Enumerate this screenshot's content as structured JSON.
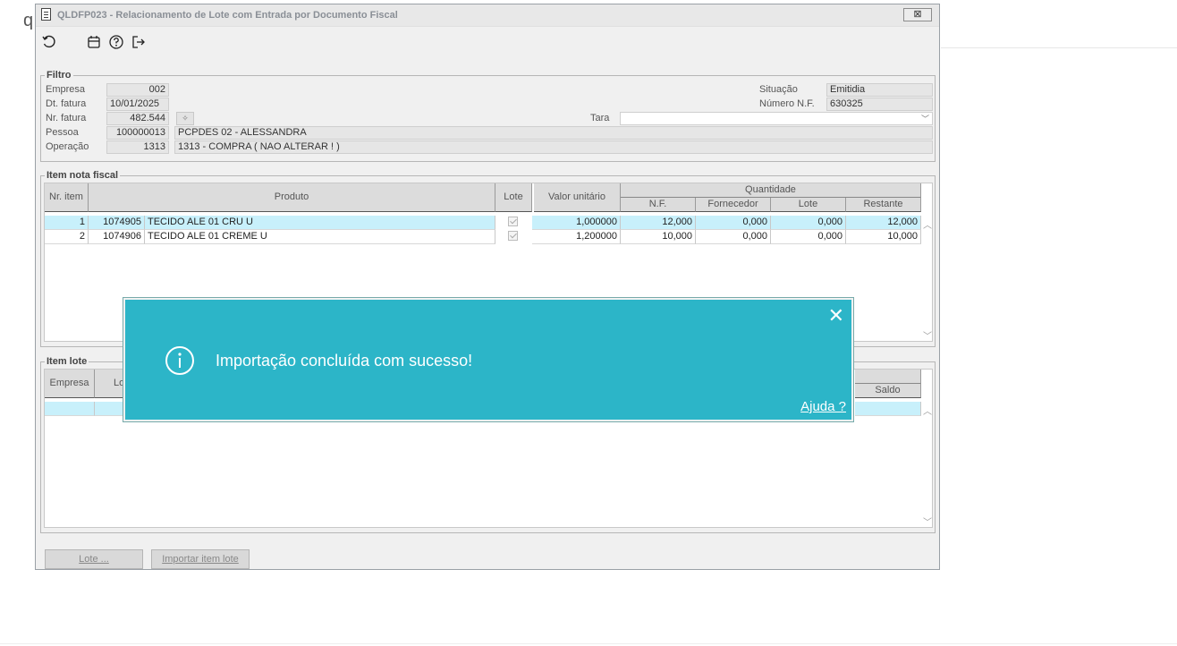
{
  "background": {
    "letter": "q"
  },
  "window": {
    "title": "QLDFP023 - Relacionamento de Lote com Entrada por Documento Fiscal",
    "close_label": "⊠"
  },
  "toolbar": {
    "icons": [
      "undo-icon",
      "calendar-icon",
      "help-icon",
      "exit-icon"
    ]
  },
  "filtro": {
    "legend": "Filtro",
    "empresa_label": "Empresa",
    "empresa_value": "002",
    "dt_fatura_label": "Dt. fatura",
    "dt_fatura_value": "10/01/2025",
    "nr_fatura_label": "Nr. fatura",
    "nr_fatura_value": "482.544",
    "pessoa_label": "Pessoa",
    "pessoa_code": "100000013",
    "pessoa_name": "PCPDES 02 - ALESSANDRA",
    "operacao_label": "Operação",
    "operacao_code": "1313",
    "operacao_desc": "1313 - COMPRA ( NAO ALTERAR ! )",
    "situacao_label": "Situação",
    "situacao_value": "Emitidia",
    "numero_nf_label": "Número N.F.",
    "numero_nf_value": "630325",
    "tara_label": "Tara",
    "tara_value": ""
  },
  "item_nota": {
    "legend": "Item nota fiscal",
    "headers": {
      "nr_item": "Nr. item",
      "produto": "Produto",
      "lote": "Lote",
      "valor_unitario": "Valor unitário",
      "quantidade": "Quantidade",
      "nf": "N.F.",
      "fornecedor": "Fornecedor",
      "q_lote": "Lote",
      "restante": "Restante"
    },
    "rows": [
      {
        "nr": "1",
        "codigo": "1074905",
        "produto": "TECIDO ALE 01 CRU U",
        "valor": "1,000000",
        "nf": "12,000",
        "fornecedor": "0,000",
        "lote": "0,000",
        "restante": "12,000"
      },
      {
        "nr": "2",
        "codigo": "1074906",
        "produto": "TECIDO ALE 01 CREME U",
        "valor": "1,200000",
        "nf": "10,000",
        "fornecedor": "0,000",
        "lote": "0,000",
        "restante": "10,000"
      }
    ]
  },
  "item_lote": {
    "legend": "Item lote",
    "headers": {
      "empresa": "Empresa",
      "lote": "Lo",
      "saldo": "Saldo"
    }
  },
  "buttons": {
    "lote": "Lote ...",
    "importar": "Importar item lote"
  },
  "toast": {
    "message": "Importação concluída com sucesso!",
    "close": "✕",
    "help": "Ajuda ?"
  }
}
